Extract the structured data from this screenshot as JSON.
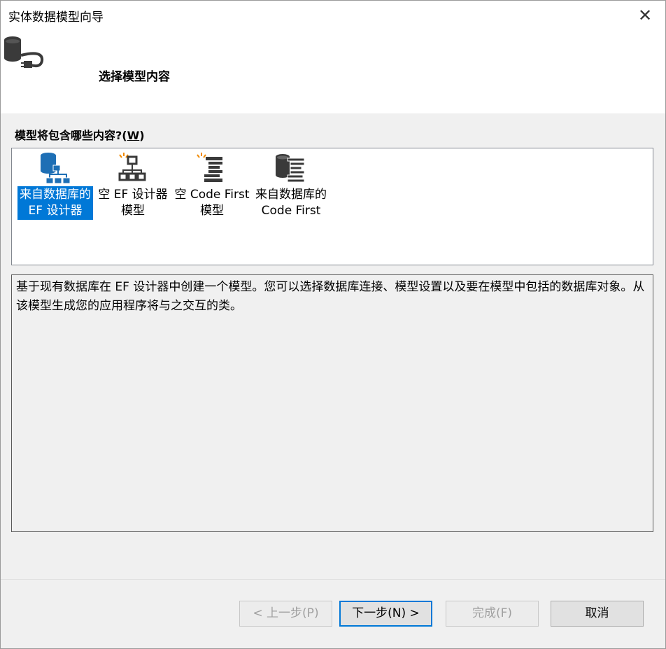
{
  "window": {
    "title": "实体数据模型向导",
    "close_glyph": "✕"
  },
  "page": {
    "heading": "选择模型内容"
  },
  "section": {
    "label": "模型将包含哪些内容?(",
    "mnemonic": "W",
    "label_end": ")"
  },
  "items": [
    {
      "label": "来自数据库的\nEF 设计器",
      "icon": "database-designer-icon",
      "selected": true
    },
    {
      "label": "空 EF 设计器\n模型",
      "icon": "empty-designer-icon",
      "selected": false
    },
    {
      "label": "空 Code First\n模型",
      "icon": "empty-code-first-icon",
      "selected": false
    },
    {
      "label": "来自数据库的\nCode First",
      "icon": "database-code-first-icon",
      "selected": false
    }
  ],
  "description": "基于现有数据库在 EF 设计器中创建一个模型。您可以选择数据库连接、模型设置以及要在模型中包括的数据库对象。从该模型生成您的应用程序将与之交互的类。",
  "buttons": {
    "back": "< 上一步(P)",
    "next": "下一步(N) >",
    "finish": "完成(F)",
    "cancel": "取消"
  },
  "colors": {
    "selection": "#0078d7",
    "accent_orange": "#f28b00"
  }
}
